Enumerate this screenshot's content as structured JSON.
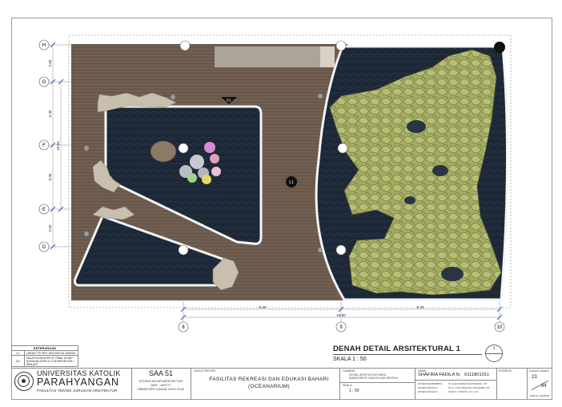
{
  "grid": {
    "rows": [
      "H",
      "G",
      "F",
      "E",
      "D"
    ],
    "cols": [
      "8",
      "9",
      "10"
    ],
    "row_dims": [
      "2.00",
      "3.40",
      "3.40",
      "2.00"
    ],
    "row_total": "10.80",
    "col_dims": [
      "8.40",
      "8.40"
    ],
    "col_total": "16.80"
  },
  "markers": {
    "section": "D1",
    "level": "L1"
  },
  "keterangan": {
    "title": "KETERANGAN",
    "rows": [
      {
        "code": "L1",
        "desc": "LANTAI TYP. WPC DECKING KA-19042DC"
      },
      {
        "code": "D1",
        "desc": "KACA KOLAM ACRYLIC TEBAL 20 MM + DUDUKAN ACRYLIC U SHAPE BETON + SEALANT"
      }
    ]
  },
  "drawing": {
    "title": "DENAH DETAIL ARSITEKTURAL 1",
    "scale": "SKALA 1 : 50",
    "number": "1"
  },
  "institution": {
    "line1": "UNIVERSITAS KATOLIK",
    "line2": "PARAHYANGAN",
    "line3": "FAKULTAS TEKNIK JURUSAN ARSITEKTUR"
  },
  "course": {
    "code": "SAA 51",
    "lines": [
      "STUDIO AKHIR ARSITEKTUR",
      "ARS - 184777",
      "SEMESTER GANJIL 2021/ 2022"
    ]
  },
  "project": {
    "label": "JUDUL PROYEK",
    "title": "FASILITAS REKREASI DAN EDUKASI BAHARI (OCEANARIUM)"
  },
  "sheet": {
    "gambar_label": "GAMBAR",
    "gambar_lines": [
      "DETAIL ARSITEKTUR AREA",
      "RAINFOREST DAN KOLAM SENTUH"
    ],
    "skala_label": "SKALA",
    "skala": "1 : 50"
  },
  "student": {
    "label": "NAMA",
    "name": "SHAFIRA FADILA N.",
    "npm": "6111801011",
    "advisor_rows": [
      [
        "DOSEN PEMBIMBING",
        "IR. ALEXANDER SASTRAWAN, MT."
      ],
      [
        "DOSEN PENGUJI",
        "IR. R. YUDI MEGUSO PRASABDI, MT"
      ],
      [
        "DOSEN PENGUJI",
        "NANCY YUSNITA, S.T., M.T."
      ]
    ],
    "koreksi": "KOREKSI"
  },
  "sheet_numbers": {
    "label_top": "NOMOR LEMBAR",
    "current": "23",
    "total": "84",
    "label_bottom": "JUMLAH LEMBAR"
  },
  "colors": {
    "deck": "#6b5a4c",
    "water": "#1c2735",
    "foliage": "#9aa85a",
    "glass_edge": "#f3f3f3"
  }
}
